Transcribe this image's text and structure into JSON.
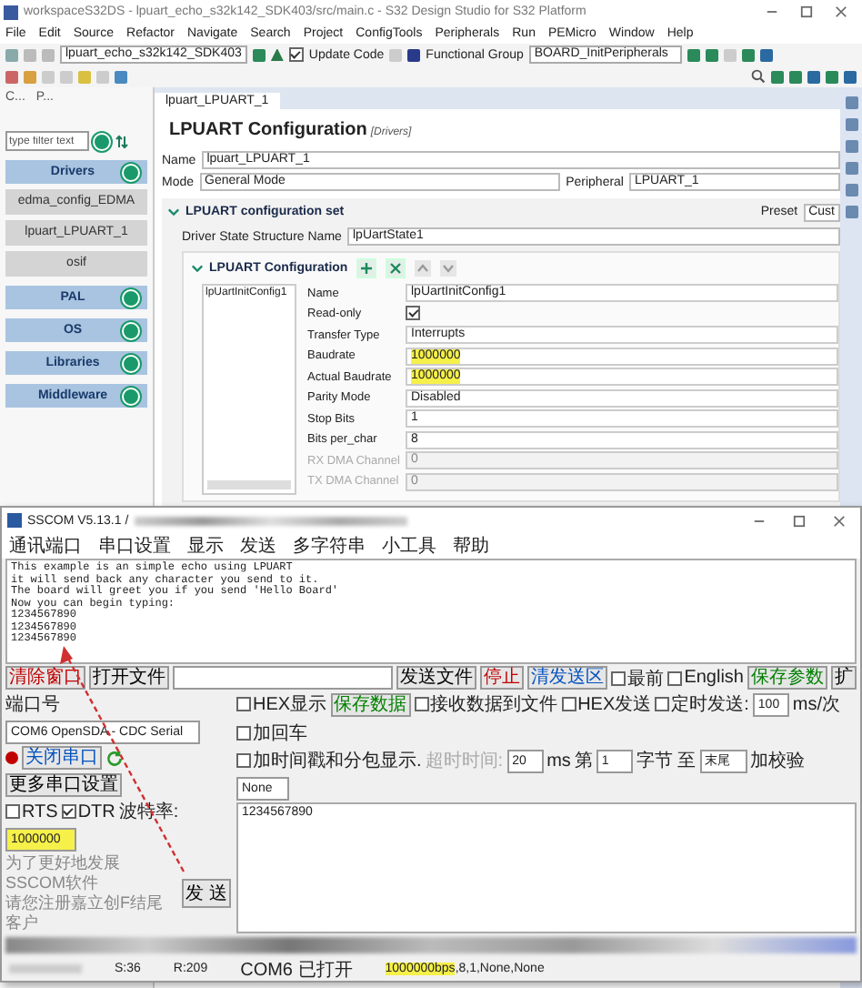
{
  "ide": {
    "title": "workspaceS32DS - lpuart_echo_s32k142_SDK403/src/main.c - S32 Design Studio for S32 Platform",
    "menu": [
      "File",
      "Edit",
      "Source",
      "Refactor",
      "Navigate",
      "Search",
      "Project",
      "ConfigTools",
      "Peripherals",
      "Run",
      "PEMicro",
      "Window",
      "Help"
    ],
    "toolbar": {
      "project": "lpuart_echo_s32k142_SDK403",
      "update_code": {
        "label": "Update Code",
        "checked": true
      },
      "functional_group_label": "Functional Group",
      "functional_group": "BOARD_InitPeripherals"
    },
    "left_panel": {
      "tabs": [
        "C...",
        "P..."
      ],
      "filter": {
        "placeholder": "type filter text"
      },
      "categories": [
        {
          "label": "Drivers",
          "children": [
            "edma_config_EDMA",
            "lpuart_LPUART_1",
            "osif"
          ]
        },
        {
          "label": "PAL"
        },
        {
          "label": "OS"
        },
        {
          "label": "Libraries"
        },
        {
          "label": "Middleware"
        }
      ]
    },
    "editor": {
      "tab": "lpuart_LPUART_1",
      "heading": "LPUART Configuration",
      "heading_tag": "[Drivers]",
      "name": {
        "label": "Name",
        "value": "lpuart_LPUART_1"
      },
      "mode": {
        "label": "Mode",
        "value": "General Mode"
      },
      "peripheral": {
        "label": "Peripheral",
        "value": "LPUART_1"
      },
      "section": {
        "title": "LPUART configuration set",
        "preset_label": "Preset",
        "preset": "Cust"
      },
      "driver_state": {
        "label": "Driver State Structure Name",
        "value": "lpUartState1"
      },
      "subsection": {
        "title": "LPUART Configuration",
        "configs": [
          "lpUartInitConfig1"
        ]
      },
      "properties": [
        {
          "kind": "text",
          "label": "Name",
          "value": "lpUartInitConfig1",
          "highlighted": false,
          "disabled": false
        },
        {
          "kind": "checkbox",
          "label": "Read-only",
          "checked": true,
          "disabled": false
        },
        {
          "kind": "text",
          "label": "Transfer Type",
          "value": "Interrupts",
          "highlighted": false,
          "disabled": false
        },
        {
          "kind": "text",
          "label": "Baudrate",
          "value": "1000000",
          "highlighted": true,
          "disabled": false
        },
        {
          "kind": "text",
          "label": "Actual Baudrate",
          "value": "1000000",
          "highlighted": true,
          "disabled": false
        },
        {
          "kind": "text",
          "label": "Parity Mode",
          "value": "Disabled",
          "highlighted": false,
          "disabled": false
        },
        {
          "kind": "text",
          "label": "Stop Bits",
          "value": "1",
          "highlighted": false,
          "disabled": false
        },
        {
          "kind": "text",
          "label": "Bits per_char",
          "value": "8",
          "highlighted": false,
          "disabled": false
        },
        {
          "kind": "text",
          "label": "RX DMA Channel",
          "value": "0",
          "highlighted": false,
          "disabled": true
        },
        {
          "kind": "text",
          "label": "TX DMA Channel",
          "value": "0",
          "highlighted": false,
          "disabled": true
        }
      ]
    }
  },
  "sscom": {
    "title": "SSCOM V5.13.1 /",
    "menu": [
      "通讯端口",
      "串口设置",
      "显示",
      "发送",
      "多字符串",
      "小工具",
      "帮助"
    ],
    "received": [
      "This example is an simple echo using LPUART",
      "it will send back any character you send to it.",
      "The board will greet you if you send 'Hello Board'",
      "Now you can begin typing:",
      "1234567890",
      "1234567890",
      "1234567890"
    ],
    "toolbar": [
      {
        "kind": "button",
        "label": "清除窗口",
        "color": "#c00000"
      },
      {
        "kind": "button",
        "label": "打开文件",
        "color": "#000000"
      },
      {
        "kind": "input"
      },
      {
        "kind": "button",
        "label": "发送文件",
        "color": "#000000"
      },
      {
        "kind": "button",
        "label": "停止",
        "color": "#c00000"
      },
      {
        "kind": "button",
        "label": "清发送区",
        "color": "#0050c0"
      },
      {
        "kind": "checkbox",
        "label": "最前",
        "checked": false
      },
      {
        "kind": "checkbox",
        "label": "English",
        "checked": false
      },
      {
        "kind": "button",
        "label": "保存参数",
        "color": "#008000"
      },
      {
        "kind": "button",
        "label": "扩",
        "color": "#000000"
      }
    ],
    "left_rows": [
      [
        {
          "kind": "label",
          "text": "端口号",
          "disabled": false
        },
        {
          "kind": "select",
          "value": "COM6 OpenSDA - CDC Serial",
          "highlighted": false
        }
      ],
      [
        {
          "kind": "led"
        },
        {
          "kind": "button",
          "label": "关闭串口",
          "color": "#0050c0"
        },
        {
          "kind": "refresh"
        },
        {
          "kind": "button",
          "label": "更多串口设置",
          "color": "#000000"
        }
      ],
      [
        {
          "kind": "checkbox",
          "label": "RTS",
          "checked": false
        },
        {
          "kind": "checkbox",
          "label": "DTR",
          "checked": true
        },
        {
          "kind": "label",
          "text": "波特率:",
          "disabled": false
        },
        {
          "kind": "select",
          "value": "1000000",
          "highlighted": true
        }
      ]
    ],
    "right_rows": [
      [
        {
          "kind": "checkbox",
          "label": "HEX显示",
          "checked": false
        },
        {
          "kind": "button",
          "label": "保存数据",
          "color": "#008000"
        },
        {
          "kind": "checkbox",
          "label": "接收数据到文件",
          "checked": false
        },
        {
          "kind": "checkbox",
          "label": "HEX发送",
          "checked": false
        },
        {
          "kind": "checkbox",
          "label": "定时发送:",
          "checked": false
        },
        {
          "kind": "input",
          "value": "100",
          "highlighted": false
        },
        {
          "kind": "label",
          "text": "ms/次",
          "disabled": false
        },
        {
          "kind": "checkbox",
          "label": "加回车",
          "checked": false
        }
      ],
      [
        {
          "kind": "checkbox",
          "label": "加时间戳和分包显示.",
          "checked": false
        },
        {
          "kind": "label",
          "text": "超时时间:",
          "disabled": true
        },
        {
          "kind": "input",
          "value": "20",
          "highlighted": false
        },
        {
          "kind": "label",
          "text": "ms",
          "disabled": false
        },
        {
          "kind": "label",
          "text": "第",
          "disabled": false
        },
        {
          "kind": "input",
          "value": "1",
          "highlighted": false
        },
        {
          "kind": "label",
          "text": "字节 至",
          "disabled": false
        },
        {
          "kind": "select",
          "value": "末尾",
          "highlighted": false
        },
        {
          "kind": "label",
          "text": "加校验",
          "disabled": false
        },
        {
          "kind": "select",
          "value": "None",
          "highlighted": false
        }
      ]
    ],
    "notice": [
      "为了更好地发展SSCOM软件",
      "请您注册嘉立创F结尾客户"
    ],
    "send_button": "发 送",
    "send_text": "1234567890",
    "status": {
      "sent": "S:36",
      "received": "R:209",
      "port": "COM6 已打开",
      "baud": "1000000bps",
      "settings": ",8,1,None,None"
    }
  }
}
